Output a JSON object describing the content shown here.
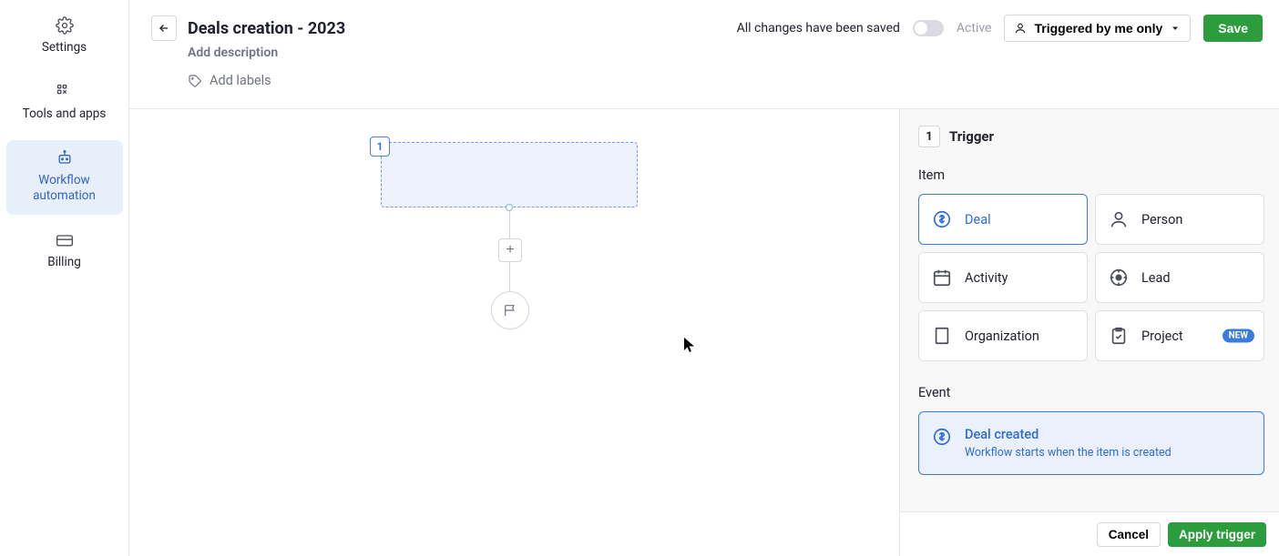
{
  "sidebar": {
    "items": [
      {
        "label": "Settings"
      },
      {
        "label": "Tools and apps"
      },
      {
        "label": "Workflow automation"
      },
      {
        "label": "Billing"
      }
    ]
  },
  "header": {
    "title": "Deals creation - 2023",
    "add_description": "Add description",
    "add_labels": "Add labels",
    "saved_text": "All changes have been saved",
    "active_label": "Active",
    "trigger_dropdown": "Triggered by me only",
    "save_label": "Save"
  },
  "canvas": {
    "step_number": "1"
  },
  "panel": {
    "badge": "1",
    "title": "Trigger",
    "item_label": "Item",
    "items": [
      {
        "label": "Deal"
      },
      {
        "label": "Person"
      },
      {
        "label": "Activity"
      },
      {
        "label": "Lead"
      },
      {
        "label": "Organization"
      },
      {
        "label": "Project",
        "new": "NEW"
      }
    ],
    "event_label": "Event",
    "event_card": {
      "title": "Deal created",
      "subtitle": "Workflow starts when the item is created"
    }
  },
  "footer": {
    "cancel": "Cancel",
    "apply": "Apply trigger"
  }
}
